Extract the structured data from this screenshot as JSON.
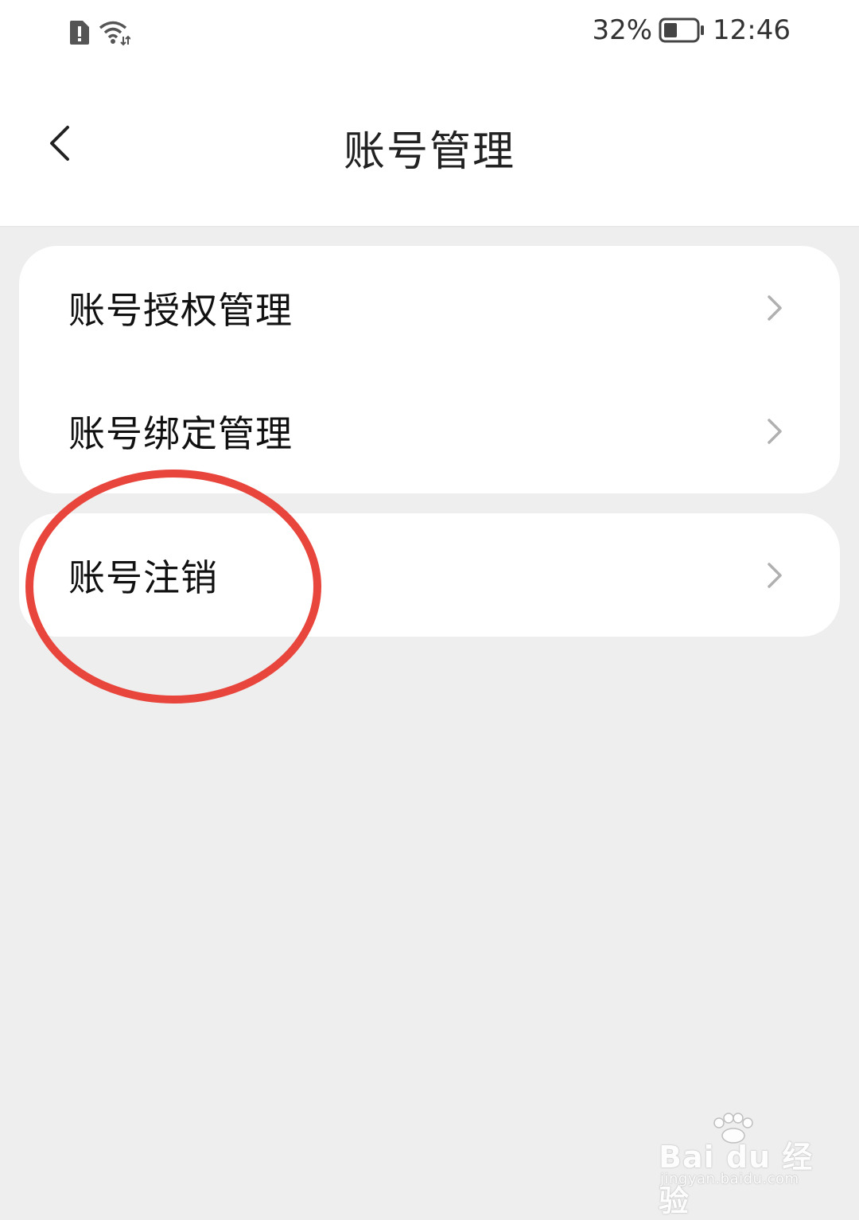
{
  "status_bar": {
    "battery_percent": "32%",
    "time": "12:46",
    "icons": [
      "sim-alert-icon",
      "wifi-icon",
      "battery-icon"
    ]
  },
  "header": {
    "title": "账号管理",
    "back_icon": "chevron-left-icon"
  },
  "menu_groups": [
    {
      "items": [
        {
          "label": "账号授权管理",
          "icon": "chevron-right-icon"
        },
        {
          "label": "账号绑定管理",
          "icon": "chevron-right-icon"
        }
      ]
    },
    {
      "items": [
        {
          "label": "账号注销",
          "icon": "chevron-right-icon"
        }
      ]
    }
  ],
  "annotation": {
    "shape": "ellipse",
    "color": "#e8453c",
    "target": "账号注销"
  },
  "watermark": {
    "brand": "Bai du 经验",
    "url": "jingyan.baidu.com"
  },
  "colors": {
    "background": "#eeeeee",
    "card": "#ffffff",
    "text": "#111111",
    "chevron": "#b0b0b0"
  }
}
